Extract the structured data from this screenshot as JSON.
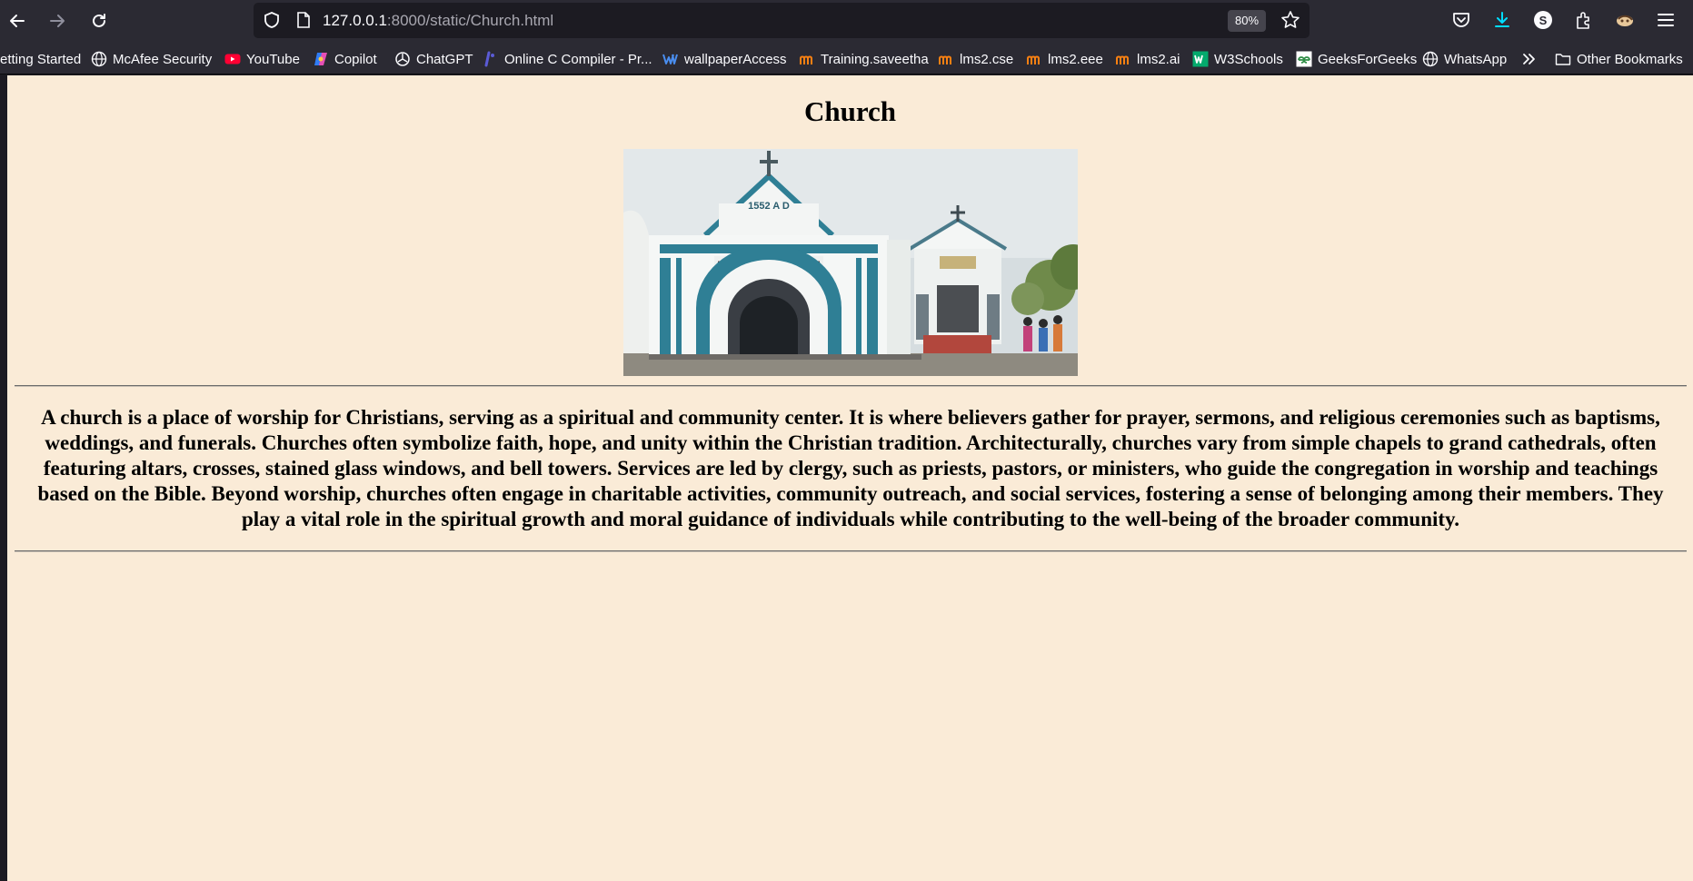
{
  "browser": {
    "url_host": "127.0.0.1",
    "url_rest": ":8000/static/Church.html",
    "zoom": "80%"
  },
  "bookmarks": [
    {
      "label": "etting Started",
      "icon": "none"
    },
    {
      "label": "McAfee Security",
      "icon": "globe-icon"
    },
    {
      "label": "YouTube",
      "icon": "youtube-icon"
    },
    {
      "label": "Copilot",
      "icon": "copilot-icon"
    },
    {
      "label": "ChatGPT",
      "icon": "chatgpt-icon"
    },
    {
      "label": "Online C Compiler - Pr...",
      "icon": "compiler-icon"
    },
    {
      "label": "wallpaperAccess",
      "icon": "wallpaper-icon"
    },
    {
      "label": "Training.saveetha",
      "icon": "moodle-icon"
    },
    {
      "label": "lms2.cse",
      "icon": "moodle-icon"
    },
    {
      "label": "lms2.eee",
      "icon": "moodle-icon"
    },
    {
      "label": "lms2.ai",
      "icon": "moodle-icon"
    },
    {
      "label": "W3Schools",
      "icon": "w3schools-icon"
    },
    {
      "label": "GeeksForGeeks",
      "icon": "geeksforgeeks-icon"
    },
    {
      "label": "WhatsApp",
      "icon": "globe-icon"
    },
    {
      "label": "Other Bookmarks",
      "icon": "folder-icon"
    }
  ],
  "page": {
    "title": "Church",
    "image_text": "1552 A D",
    "description": "A church is a place of worship for Christians, serving as a spiritual and community center. It is where believers gather for prayer, sermons, and religious ceremonies such as baptisms, weddings, and funerals. Churches often symbolize faith, hope, and unity within the Christian tradition. Architecturally, churches vary from simple chapels to grand cathedrals, often featuring altars, crosses, stained glass windows, and bell towers. Services are led by clergy, such as priests, pastors, or ministers, who guide the congregation in worship and teachings based on the Bible. Beyond worship, churches often engage in charitable activities, community outreach, and social services, fostering a sense of belonging among their members. They play a vital role in the spiritual growth and moral guidance of individuals while contributing to the well-being of the broader community."
  },
  "colors": {
    "page_background": "#faebd7",
    "toolbar": "#2b2a33",
    "accent_download": "#00ddff"
  }
}
